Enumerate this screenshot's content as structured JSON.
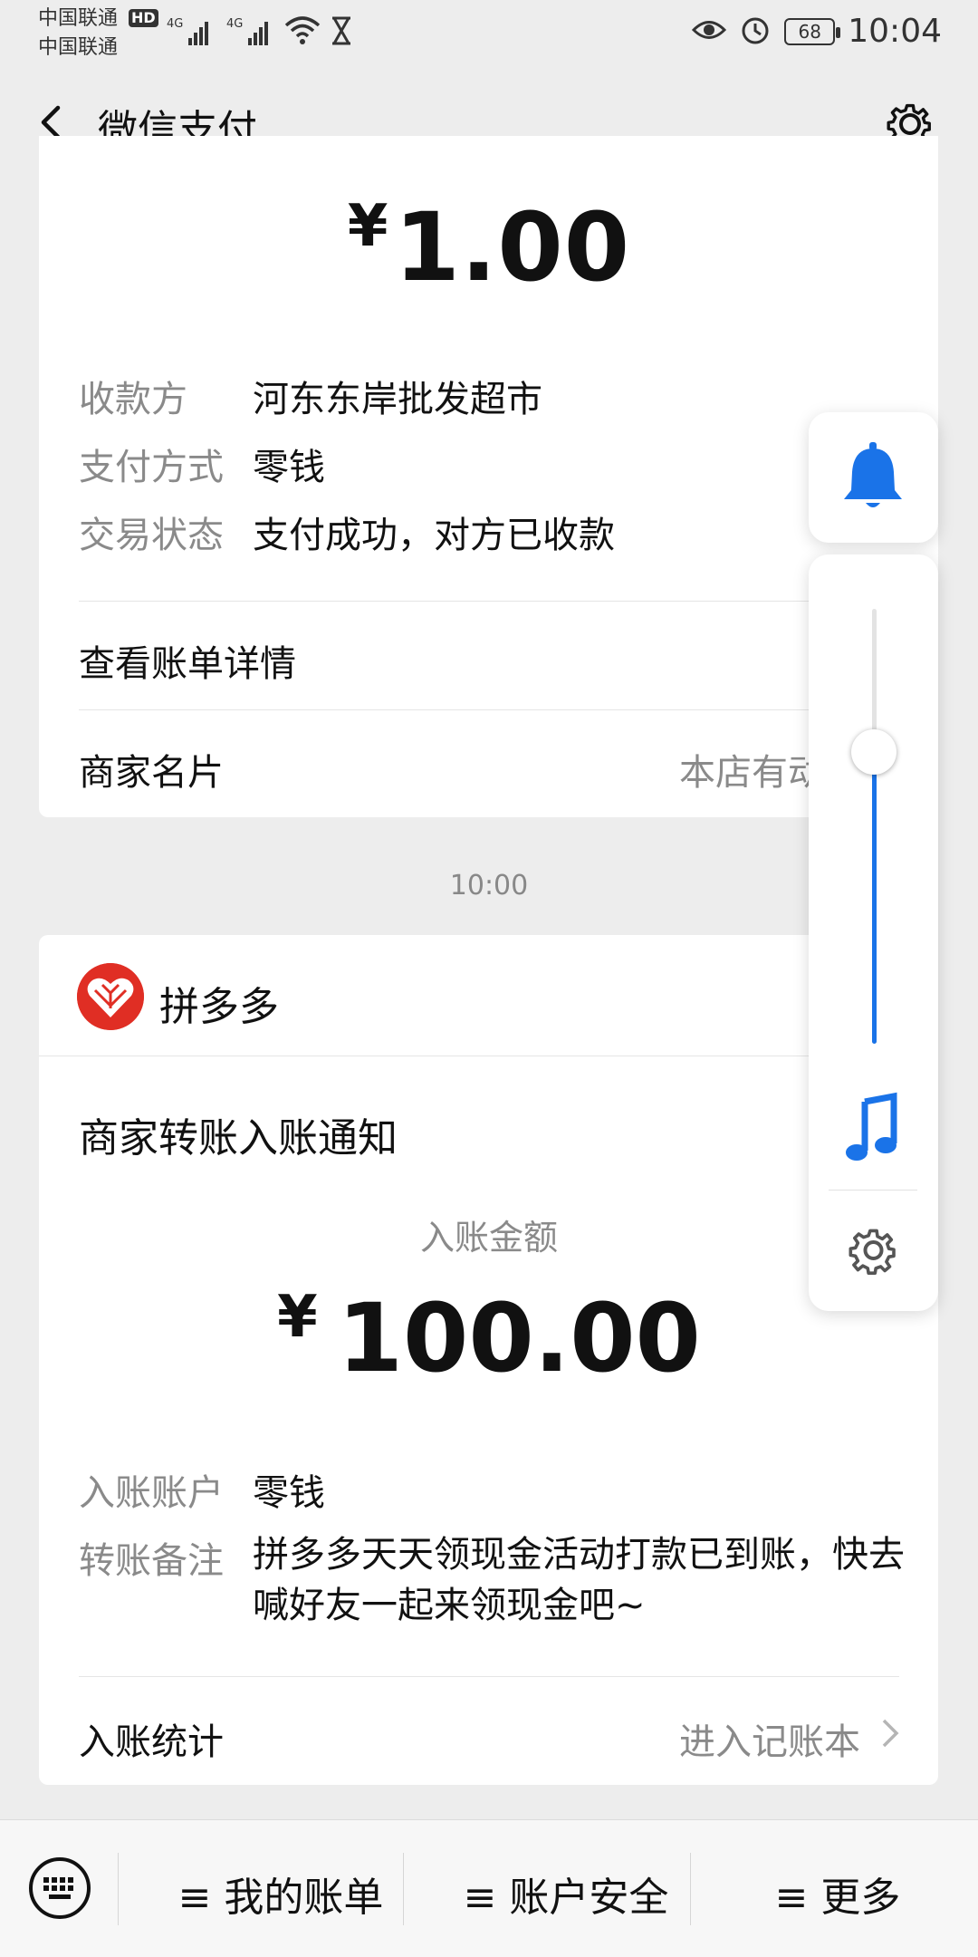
{
  "status_bar": {
    "carrier_1": "中国联通",
    "carrier_2": "中国联通",
    "hd": "HD",
    "net_1": "4G",
    "net_2": "4G",
    "battery": "68",
    "time": "10:04"
  },
  "nav": {
    "title": "微信支付",
    "back_icon": "back-chevron-icon",
    "settings_icon": "gear-icon"
  },
  "payment": {
    "currency": "¥",
    "amount": "1.00",
    "fields": [
      {
        "label": "收款方",
        "value": "河东东岸批发超市"
      },
      {
        "label": "支付方式",
        "value": "零钱"
      },
      {
        "label": "交易状态",
        "value": "支付成功，对方已收款"
      }
    ],
    "detail_link": "查看账单详情",
    "merchant_card_label": "商家名片",
    "merchant_card_right": "本店有动态"
  },
  "timestamp": "10:00",
  "transfer": {
    "sender": "拼多多",
    "title": "商家转账入账通知",
    "amount_label": "入账金额",
    "currency": "¥",
    "amount": "100.00",
    "fields": [
      {
        "label": "入账账户",
        "value": "零钱"
      },
      {
        "label": "转账备注",
        "value": "拼多多天天领现金活动打款已到账，快去喊好友一起来领现金吧~"
      }
    ],
    "stats_label": "入账统计",
    "stats_link": "进入记账本"
  },
  "bottom_bar": {
    "keyboard_icon": "keyboard-icon",
    "items": [
      "≡ 我的账单",
      "≡ 账户安全",
      "≡ 更多"
    ]
  },
  "volume_overlay": {
    "bell_icon": "bell-icon",
    "music_icon": "music-note-icon",
    "settings_icon": "gear-icon",
    "level_fraction": 0.67,
    "accent": "#1a73e8"
  }
}
